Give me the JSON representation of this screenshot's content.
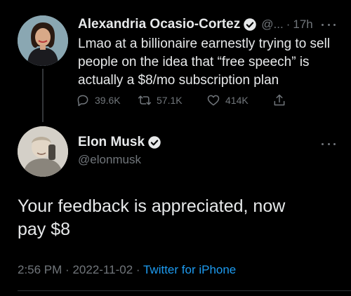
{
  "tweet1": {
    "author_name": "Alexandria Ocasio-Cortez",
    "handle": "@...",
    "separator": "·",
    "time": "17h",
    "text_lines": [
      "Lmao at a billionaire earnestly trying to sell",
      "people on the idea that “free speech” is",
      "actually a $8/mo subscription plan"
    ],
    "replies": "39.6K",
    "retweets": "57.1K",
    "likes": "414K"
  },
  "tweet2": {
    "author_name": "Elon Musk",
    "handle": "@elonmusk",
    "text_lines": [
      "Your feedback is appreciated, now",
      "pay $8"
    ],
    "time": "2:56 PM",
    "separator": "·",
    "date": "2022-11-02",
    "source": "Twitter for iPhone"
  },
  "icons": {
    "verified": "verified-badge-icon",
    "more": "more-options-icon",
    "reply": "reply-icon",
    "retweet": "retweet-icon",
    "like": "heart-icon",
    "share": "share-icon"
  },
  "colors": {
    "background": "#000000",
    "text": "#e7e9ea",
    "secondary": "#71767b",
    "link": "#1d9bf0",
    "verified": "#1d9bf0"
  }
}
